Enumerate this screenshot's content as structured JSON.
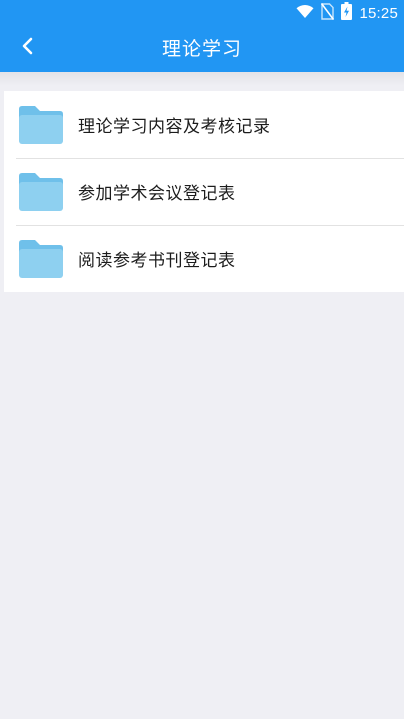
{
  "status_bar": {
    "time": "15:25",
    "icons": [
      "wifi-icon",
      "no-sim-icon",
      "battery-charging-icon"
    ]
  },
  "header": {
    "back_icon": "chevron-left-icon",
    "title": "理论学习"
  },
  "colors": {
    "primary": "#2196f3",
    "background": "#efeff4",
    "folder": "#8ed0f0"
  },
  "list": {
    "items": [
      {
        "label": "理论学习内容及考核记录",
        "icon": "folder-icon"
      },
      {
        "label": "参加学术会议登记表",
        "icon": "folder-icon"
      },
      {
        "label": "阅读参考书刊登记表",
        "icon": "folder-icon"
      }
    ]
  }
}
